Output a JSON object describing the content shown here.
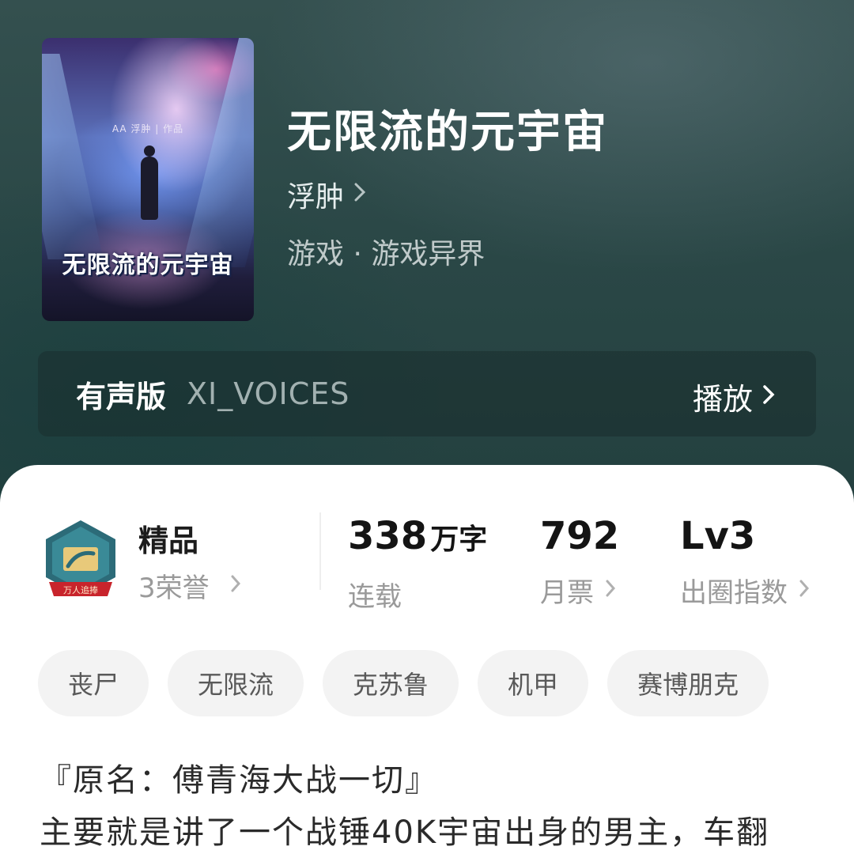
{
  "book": {
    "cover_title": "无限流的元宇宙",
    "cover_byline": "AA 浮肿 | 作品",
    "title": "无限流的元宇宙",
    "author": "浮肿",
    "genre": "游戏 · 游戏异界"
  },
  "audio": {
    "label": "有声版",
    "voice": "XI_VOICES",
    "play_label": "播放"
  },
  "stats": {
    "badge_ribbon": "万人追捧",
    "premium_label": "精品",
    "honors": "3荣誉",
    "word_count": "338",
    "word_unit": "万字",
    "status": "连载",
    "monthly_votes": "792",
    "monthly_votes_label": "月票",
    "level": "Lv3",
    "level_label": "出圈指数"
  },
  "tags": [
    "丧尸",
    "无限流",
    "克苏鲁",
    "机甲",
    "赛博朋克"
  ],
  "description": {
    "line1": "『原名：傅青海大战一切』",
    "line2": "主要就是讲了一个战锤40K宇宙出身的男主，车翻"
  },
  "icons": {
    "chevron": "chevron-right-icon"
  }
}
